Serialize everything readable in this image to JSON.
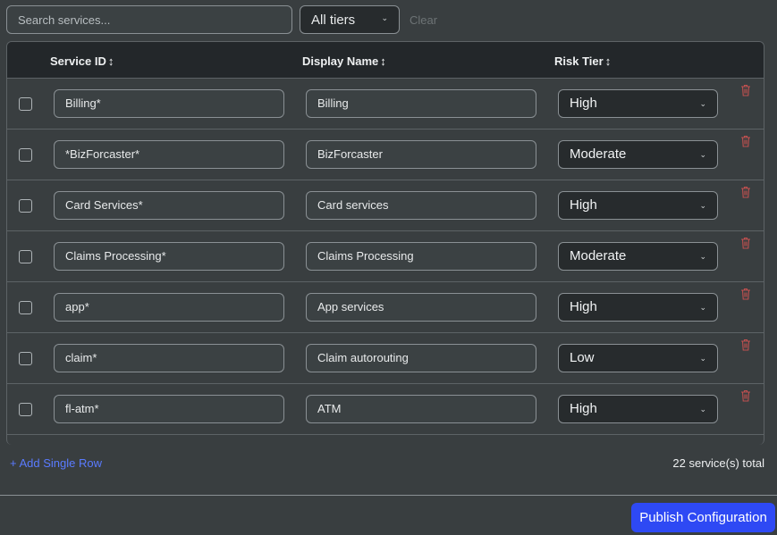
{
  "toolbar": {
    "search_placeholder": "Search services...",
    "tier_filter_value": "All tiers",
    "clear_label": "Clear"
  },
  "table": {
    "columns": [
      {
        "label": "Service ID"
      },
      {
        "label": "Display Name"
      },
      {
        "label": "Risk Tier"
      }
    ],
    "sort_glyph": "↕",
    "rows": [
      {
        "service_id": "Billing*",
        "display_name": "Billing",
        "risk_tier": "High"
      },
      {
        "service_id": "*BizForcaster*",
        "display_name": "BizForcaster",
        "risk_tier": "Moderate"
      },
      {
        "service_id": "Card Services*",
        "display_name": "Card services",
        "risk_tier": "High"
      },
      {
        "service_id": "Claims Processing*",
        "display_name": "Claims Processing",
        "risk_tier": "Moderate"
      },
      {
        "service_id": "app*",
        "display_name": "App services",
        "risk_tier": "High"
      },
      {
        "service_id": "claim*",
        "display_name": "Claim autorouting",
        "risk_tier": "Low"
      },
      {
        "service_id": "fl-atm*",
        "display_name": "ATM",
        "risk_tier": "High"
      }
    ]
  },
  "footer": {
    "add_row_label": "+ Add Single Row",
    "total_label": "22 service(s) total",
    "publish_label": "Publish Configuration"
  },
  "icons": {
    "delete": "trash-icon",
    "dropdown": "chevron-down-icon"
  },
  "colors": {
    "accent": "#2e49f4",
    "link": "#5a7bff",
    "delete_icon": "#c0504f"
  }
}
